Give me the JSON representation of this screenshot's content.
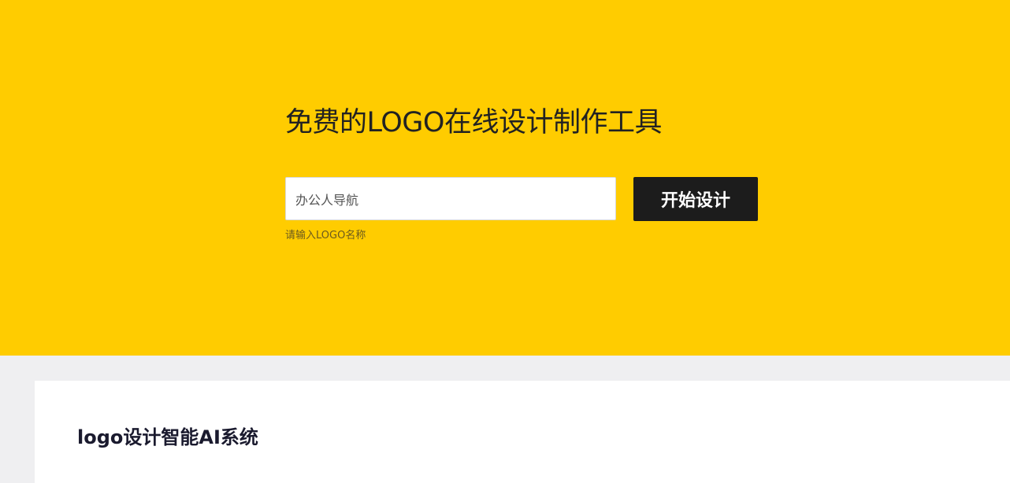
{
  "hero": {
    "title": "免费的LOGO在线设计制作工具",
    "input_value": "办公人导航",
    "start_button_label": "开始设计",
    "input_hint": "请输入LOGO名称"
  },
  "section": {
    "title": "logo设计智能AI系统"
  },
  "colors": {
    "hero_background": "#ffcc00",
    "button_background": "#1c1c1c",
    "page_background": "#efeff1"
  }
}
